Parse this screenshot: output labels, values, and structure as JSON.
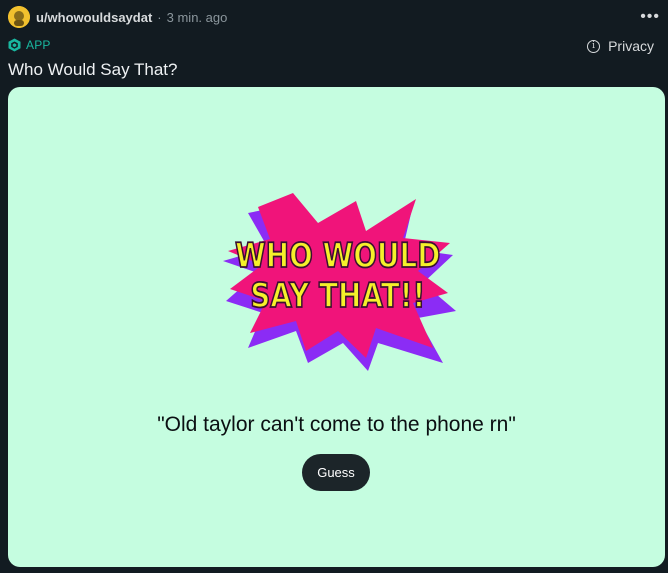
{
  "post": {
    "username": "u/whowouldsaydat",
    "separator": "·",
    "timestamp": "3 min. ago",
    "more_label": "•••",
    "app_badge": "APP",
    "privacy_label": "Privacy",
    "title": "Who Would Say That?"
  },
  "app": {
    "logo_line1": "WHO WOULD",
    "logo_line2": "SAY THAT!!",
    "quote": "\"Old taylor can't come to the phone rn\"",
    "guess_label": "Guess"
  },
  "colors": {
    "background": "#121b21",
    "card": "#c5fde0",
    "accent_app": "#19b8a0",
    "button": "#1c2529",
    "logo_pink": "#f0147a",
    "logo_purple": "#8b2cf5",
    "logo_yellow": "#f5f02a"
  }
}
